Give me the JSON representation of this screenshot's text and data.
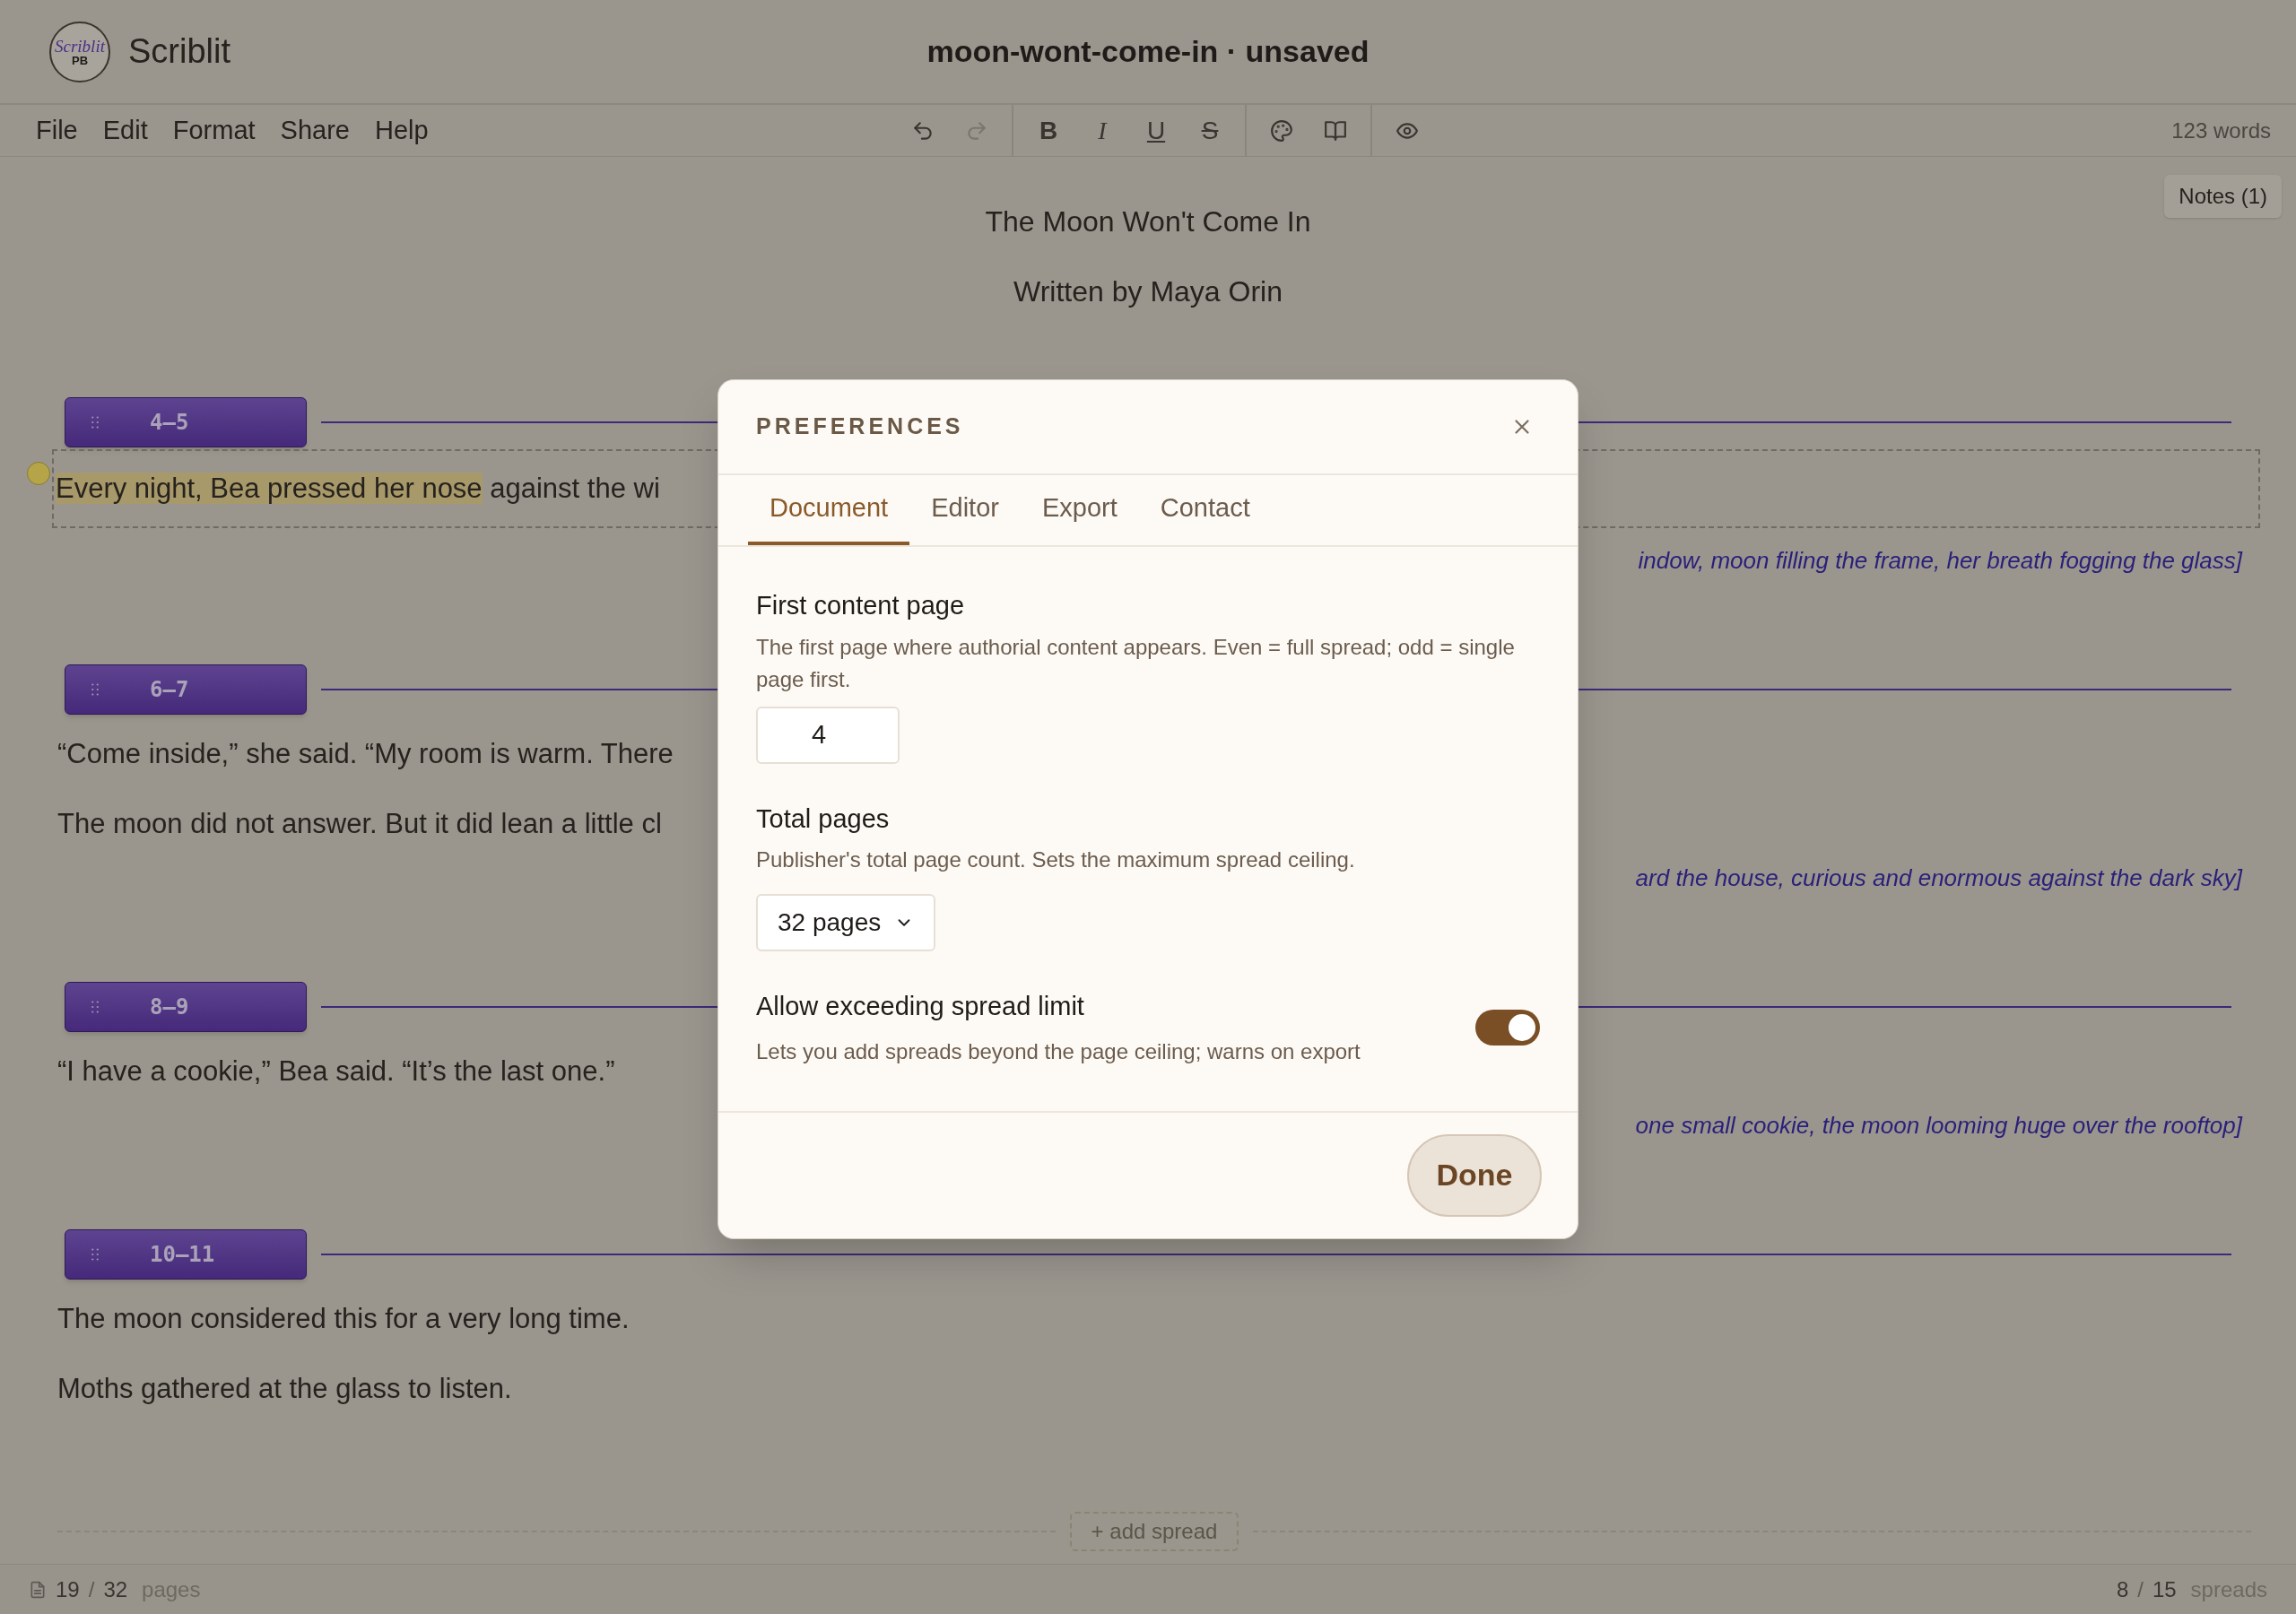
{
  "app": {
    "name": "Scriblit",
    "logo_script": "Scriblit",
    "logo_badge": "PB"
  },
  "document_title": "moon-wont-come-in · unsaved",
  "menu": [
    "File",
    "Edit",
    "Format",
    "Share",
    "Help"
  ],
  "toolbar": [
    [
      {
        "kind": "undo",
        "disabled": false
      },
      {
        "kind": "redo",
        "disabled": true
      }
    ],
    [
      {
        "kind": "bold",
        "glyph": "B"
      },
      {
        "kind": "italic",
        "glyph": "I"
      },
      {
        "kind": "underline",
        "glyph": "U"
      },
      {
        "kind": "strike",
        "glyph": "S"
      }
    ],
    [
      {
        "kind": "palette",
        "disabled": false
      },
      {
        "kind": "book",
        "disabled": false
      }
    ],
    [
      {
        "kind": "eye",
        "disabled": false
      }
    ]
  ],
  "word_count": "123 words",
  "notes_button": "Notes (1)",
  "manuscript": {
    "title": "The Moon Won't Come In",
    "byline": "Written by Maya Orin",
    "spreads": [
      {
        "label": "4–5",
        "paragraphs": [
          {
            "selected": true,
            "has_note": true,
            "segments": [
              {
                "text": "Every night, Bea pressed her nose",
                "highlighted": true
              },
              {
                "text": " against the wi",
                "highlighted": false
              }
            ]
          }
        ],
        "art_note": "indow, moon filling the frame, her breath fogging the glass]"
      },
      {
        "label": "6–7",
        "paragraphs": [
          {
            "selected": false,
            "has_note": false,
            "segments": [
              {
                "text": "“Come inside,” she said. “My room is warm. There",
                "highlighted": false
              }
            ]
          },
          {
            "selected": false,
            "has_note": false,
            "segments": [
              {
                "text": "The moon did not answer. But it did lean a little cl",
                "highlighted": false
              }
            ]
          }
        ],
        "art_note": "ard the house, curious and enormous against the dark sky]"
      },
      {
        "label": "8–9",
        "paragraphs": [
          {
            "selected": false,
            "has_note": false,
            "segments": [
              {
                "text": "“I have a cookie,” Bea said. “It’s the last one.”",
                "highlighted": false
              }
            ]
          }
        ],
        "art_note": "one small cookie, the moon looming huge over the rooftop]"
      },
      {
        "label": "10–11",
        "paragraphs": [
          {
            "selected": false,
            "has_note": false,
            "segments": [
              {
                "text": "The moon considered this for a very long time.",
                "highlighted": false
              }
            ]
          },
          {
            "selected": false,
            "has_note": false,
            "segments": [
              {
                "text": "Moths gathered at the glass to listen.",
                "highlighted": false
              }
            ]
          }
        ]
      }
    ],
    "add_spread": "+ add spread"
  },
  "status_bar": {
    "pages": {
      "current": "19",
      "separator": "/",
      "total": "32",
      "unit": "pages"
    },
    "spreads": {
      "current": "8",
      "separator": "/",
      "total": "15",
      "unit": "spreads"
    }
  },
  "dialog": {
    "title": "PREFERENCES",
    "tabs": [
      {
        "label": "Document",
        "selected": true
      },
      {
        "label": "Editor",
        "selected": false
      },
      {
        "label": "Export",
        "selected": false
      },
      {
        "label": "Contact",
        "selected": false
      }
    ],
    "fields": [
      {
        "kind": "number",
        "label": "First content page",
        "help": "The first page where authorial content appears. Even = full spread; odd = single page first.",
        "value": "4"
      },
      {
        "kind": "select",
        "label": "Total pages",
        "help": "Publisher's total page count. Sets the maximum spread ceiling.",
        "value": "32 pages"
      },
      {
        "kind": "toggle",
        "label": "Allow exceeding spread limit",
        "help": "Lets you add spreads beyond the page ceiling; warns on export",
        "on": true
      }
    ],
    "done_button": "Done"
  }
}
